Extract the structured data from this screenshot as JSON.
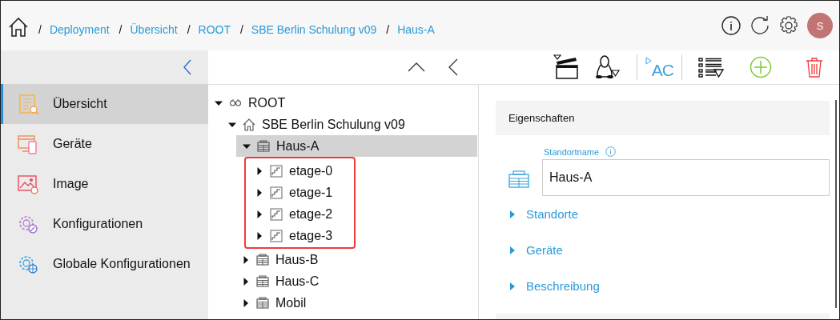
{
  "breadcrumb": [
    {
      "separator": "/",
      "label": "Deployment"
    },
    {
      "separator": "/",
      "label": "Übersicht"
    },
    {
      "separator": "/",
      "label": "ROOT"
    },
    {
      "separator": "/",
      "label": "SBE Berlin Schulung v09"
    },
    {
      "separator": "/",
      "label": "Haus-A"
    }
  ],
  "user": {
    "initial": "S"
  },
  "sidebar": {
    "items": [
      {
        "kind": "overview",
        "label": "Übersicht",
        "selected": true
      },
      {
        "kind": "devices",
        "label": "Geräte",
        "selected": false
      },
      {
        "kind": "image",
        "label": "Image",
        "selected": false
      },
      {
        "kind": "config",
        "label": "Konfigurationen",
        "selected": false
      },
      {
        "kind": "global",
        "label": "Globale Konfigurationen",
        "selected": false
      }
    ]
  },
  "toolbar": {
    "ac_label": "AC"
  },
  "tree": [
    {
      "kind": "root",
      "label": "ROOT",
      "expanded": true,
      "selected": false,
      "children": [
        {
          "kind": "site",
          "label": "SBE Berlin Schulung v09",
          "expanded": true,
          "selected": false,
          "children": [
            {
              "kind": "building",
              "label": "Haus-A",
              "expanded": true,
              "selected": true,
              "highlight_children": true,
              "children": [
                {
                  "kind": "floor",
                  "label": "etage-0",
                  "expanded": false,
                  "selected": false
                },
                {
                  "kind": "floor",
                  "label": "etage-1",
                  "expanded": false,
                  "selected": false
                },
                {
                  "kind": "floor",
                  "label": "etage-2",
                  "expanded": false,
                  "selected": false
                },
                {
                  "kind": "floor",
                  "label": "etage-3",
                  "expanded": false,
                  "selected": false
                }
              ]
            },
            {
              "kind": "building",
              "label": "Haus-B",
              "expanded": false,
              "selected": false
            },
            {
              "kind": "building",
              "label": "Haus-C",
              "expanded": false,
              "selected": false
            },
            {
              "kind": "building",
              "label": "Mobil",
              "expanded": false,
              "selected": false
            }
          ]
        }
      ]
    }
  ],
  "properties": {
    "title": "Eigenschaften",
    "field": {
      "label": "Standortname",
      "value": "Haus-A"
    },
    "sections": [
      {
        "label": "Standorte",
        "expanded": false
      },
      {
        "label": "Geräte",
        "expanded": false
      },
      {
        "label": "Beschreibung",
        "expanded": false
      }
    ]
  }
}
